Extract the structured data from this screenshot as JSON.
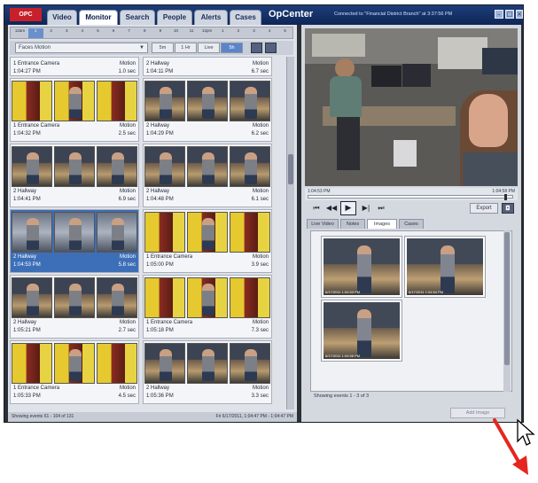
{
  "app": {
    "logo": "OPC",
    "title": "OpCenter",
    "connection": "Connected to \"Financial District Branch\" at 3:37:56 PM",
    "tabs": [
      "Video",
      "Monitor",
      "Search",
      "People",
      "Alerts",
      "Cases"
    ],
    "active_tab": "Monitor"
  },
  "hours": [
    "12am",
    "1",
    "2",
    "3",
    "4",
    "5",
    "6",
    "7",
    "8",
    "9",
    "10",
    "11",
    "12pm",
    "1",
    "2",
    "3",
    "4",
    "5"
  ],
  "filter": {
    "selected": "Faces Motion",
    "segments": [
      "5m",
      "1 Hr",
      "Live",
      "5h"
    ],
    "selected_segment": "5h"
  },
  "events": [
    {
      "camera": "1 Entrance Camera",
      "time": "1:04:27 PM",
      "label": "Motion",
      "duration": "1.0 sec",
      "kind": "hall",
      "partial": true
    },
    {
      "camera": "2 Hallway",
      "time": "1:04:11 PM",
      "label": "Motion",
      "duration": "6.7 sec",
      "kind": "hall",
      "partial": true
    },
    {
      "camera": "1 Entrance Camera",
      "time": "1:04:32 PM",
      "label": "Motion",
      "duration": "2.5 sec",
      "kind": "entr"
    },
    {
      "camera": "2 Hallway",
      "time": "1:04:29 PM",
      "label": "Motion",
      "duration": "6.2 sec",
      "kind": "hall"
    },
    {
      "camera": "2 Hallway",
      "time": "1:04:41 PM",
      "label": "Motion",
      "duration": "6.9 sec",
      "kind": "hall"
    },
    {
      "camera": "2 Hallway",
      "time": "1:04:48 PM",
      "label": "Motion",
      "duration": "6.1 sec",
      "kind": "hall"
    },
    {
      "camera": "2 Hallway",
      "time": "1:04:53 PM",
      "label": "Motion",
      "duration": "5.8 sec",
      "kind": "gray",
      "selected": true
    },
    {
      "camera": "1 Entrance Camera",
      "time": "1:05:00 PM",
      "label": "Motion",
      "duration": "3.9 sec",
      "kind": "entr"
    },
    {
      "camera": "2 Hallway",
      "time": "1:05:21 PM",
      "label": "Motion",
      "duration": "2.7 sec",
      "kind": "hall"
    },
    {
      "camera": "1 Entrance Camera",
      "time": "1:05:18 PM",
      "label": "Motion",
      "duration": "7.3 sec",
      "kind": "entr"
    },
    {
      "camera": "1 Entrance Camera",
      "time": "1:05:33 PM",
      "label": "Motion",
      "duration": "4.5 sec",
      "kind": "entr"
    },
    {
      "camera": "2 Hallway",
      "time": "1:05:36 PM",
      "label": "Motion",
      "duration": "3.3 sec",
      "kind": "hall"
    }
  ],
  "left_status": {
    "left": "Showing events 61 - 104 of 131",
    "right": "Fri 6/17/2011, 1:04:47 PM - 1:04:47 PM"
  },
  "timeline": {
    "start": "1:04:53 PM",
    "end": "1:04:58 PM",
    "position": 0.97
  },
  "controls": {
    "prev_label": "⏮",
    "rewind_label": "◀◀",
    "play_label": "▶",
    "step_label": "▶|",
    "next_label": "⏭",
    "export_label": "Export"
  },
  "subtabs": [
    "Live Video",
    "Notes",
    "Images",
    "Cases"
  ],
  "active_subtab": "Images",
  "images": [
    {
      "ts": "6/17/2011 1:04:53 PM"
    },
    {
      "ts": "6/17/2011 1:04:54 PM"
    },
    {
      "ts": "6/17/2011 1:04:56 PM"
    }
  ],
  "image_status": "Showing events 1 - 3 of 3",
  "add_image_label": "Add Image",
  "colors": {
    "titlebar": "#1d3d7a",
    "selection": "#3d6fb8",
    "annotation_arrow": "#e4261e"
  }
}
